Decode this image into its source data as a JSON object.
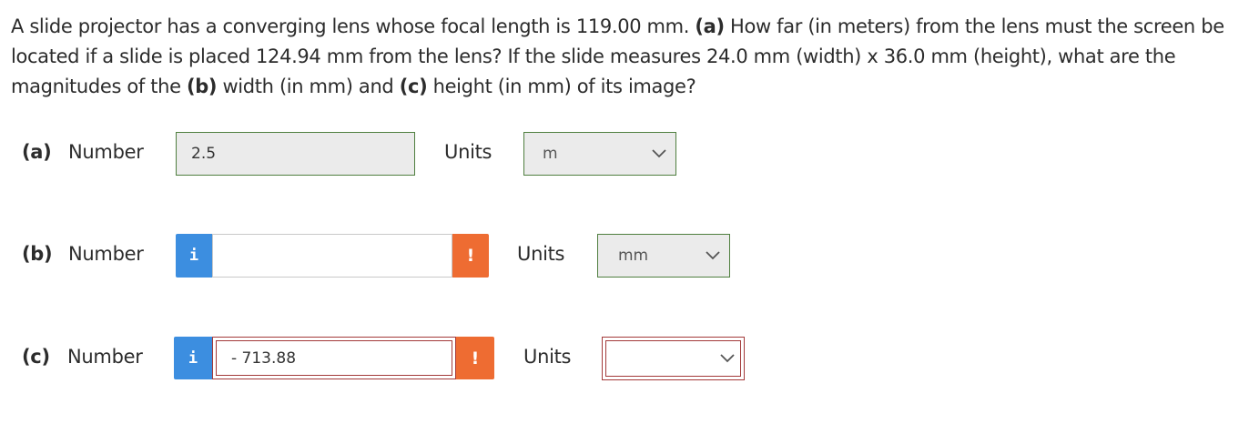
{
  "question": {
    "part1": "A slide projector has a converging lens whose focal length is 119.00 mm. ",
    "tag_a": "(a)",
    "part2": " How far (in meters) from the lens must the screen be located if a slide is placed 124.94 mm from the lens? If the slide measures 24.0 mm (width) x 36.0 mm (height), what are the magnitudes of the ",
    "tag_b": "(b)",
    "part3": " width (in mm) and ",
    "tag_c": "(c)",
    "part4": " height (in mm) of its image?"
  },
  "rows": [
    {
      "label": "(a)",
      "word": "Number",
      "value": "2.5",
      "units_label": "Units",
      "unit_value": "m",
      "status": "correct"
    },
    {
      "label": "(b)",
      "word": "Number",
      "value": "",
      "info_glyph": "i",
      "warn_glyph": "!",
      "units_label": "Units",
      "unit_value": "mm",
      "status": "incorrect"
    },
    {
      "label": "(c)",
      "word": "Number",
      "value": "- 713.88",
      "info_glyph": "i",
      "warn_glyph": "!",
      "units_label": "Units",
      "unit_value": "",
      "status": "incorrect"
    }
  ],
  "icons": {
    "info": "info-icon",
    "warning": "exclamation-icon",
    "dropdown": "chevron-down-icon"
  },
  "colors": {
    "correct_border": "#4f7f3f",
    "incorrect_border": "#a33a3a",
    "info_blue": "#3c8ee0",
    "warn_orange": "#ee6c32",
    "locked_bg": "#ebebeb"
  }
}
